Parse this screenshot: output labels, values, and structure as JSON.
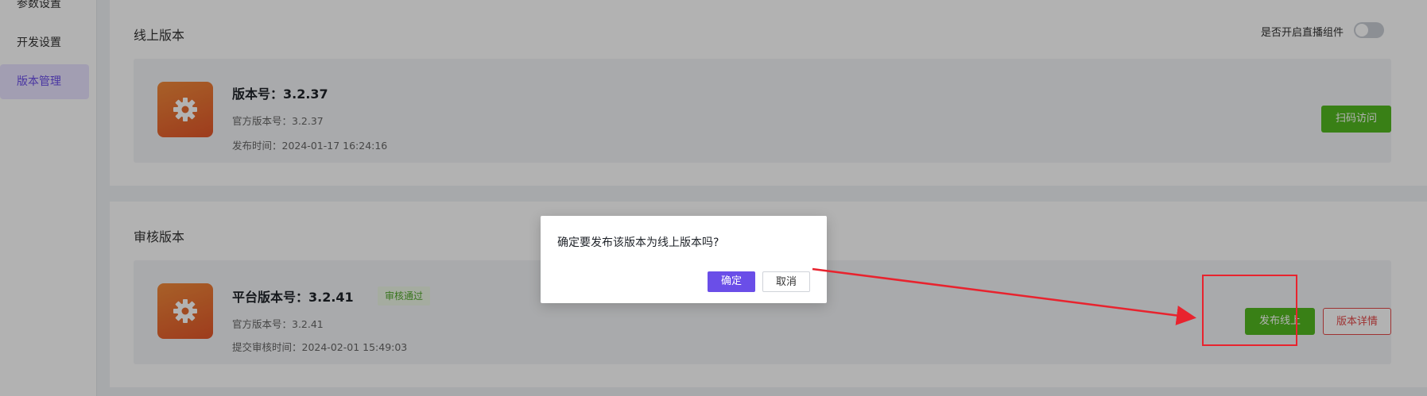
{
  "sidebar": {
    "items": [
      {
        "label": "参数设置"
      },
      {
        "label": "开发设置"
      },
      {
        "label": "版本管理"
      }
    ]
  },
  "online": {
    "section_title": "线上版本",
    "toggle_label": "是否开启直播组件",
    "toggle_on": false,
    "version_title": "版本号：3.2.37",
    "official_version": "官方版本号：3.2.37",
    "release_time": "发布时间：2024-01-17 16:24:16",
    "scan_button": "扫码访问"
  },
  "review": {
    "section_title": "审核版本",
    "version_title": "平台版本号：3.2.41",
    "status_badge": "审核通过",
    "official_version": "官方版本号：3.2.41",
    "submit_time": "提交审核时间：2024-02-01 15:49:03",
    "publish_button": "发布线上",
    "details_button": "版本详情"
  },
  "dialog": {
    "message": "确定要发布该版本为线上版本吗?",
    "confirm_label": "确定",
    "cancel_label": "取消"
  },
  "colors": {
    "accent": "#6a4ee8",
    "success": "#52b820",
    "danger": "#e34848",
    "annotation": "#e8232e"
  }
}
